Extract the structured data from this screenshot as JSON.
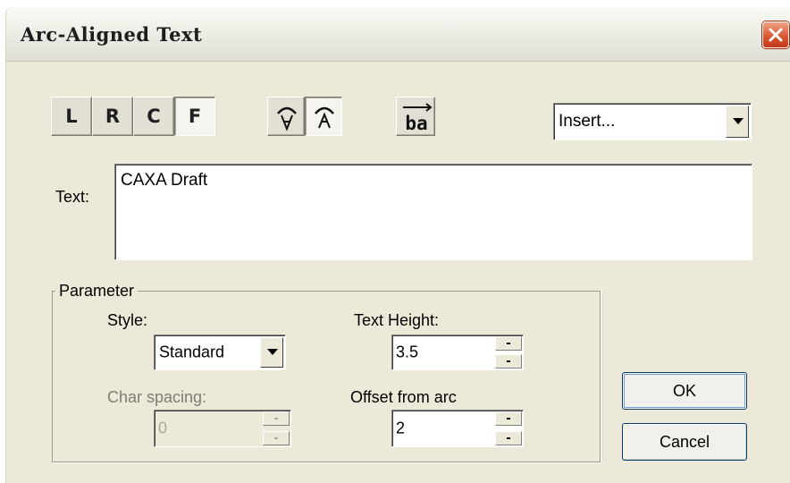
{
  "window": {
    "title": "Arc-Aligned Text"
  },
  "toolbar": {
    "align": [
      {
        "label": "L",
        "pressed": false
      },
      {
        "label": "R",
        "pressed": false
      },
      {
        "label": "C",
        "pressed": false
      },
      {
        "label": "F",
        "pressed": true
      }
    ],
    "arc_side_icons": [
      {
        "name": "text-below-arc-icon",
        "pressed": false
      },
      {
        "name": "text-above-arc-icon",
        "pressed": true
      }
    ],
    "reverse_text_icon": {
      "name": "reverse-text-direction-icon",
      "text": "ba"
    },
    "insert_dropdown": {
      "value": "Insert..."
    }
  },
  "text_field": {
    "label": "Text:",
    "value": "CAXA Draft"
  },
  "parameter": {
    "group_label": "Parameter",
    "style": {
      "label": "Style:",
      "value": "Standard"
    },
    "text_height": {
      "label": "Text Height:",
      "value": "3.5"
    },
    "char_spacing": {
      "label": "Char spacing:",
      "value": "0",
      "disabled": true
    },
    "offset_from_arc": {
      "label": "Offset from arc",
      "value": "2"
    }
  },
  "buttons": {
    "ok": "OK",
    "cancel": "Cancel"
  },
  "colors": {
    "dialog_bg": "#ece9d8",
    "close_button": "#d8532f",
    "default_button_ring": "#7a98d0"
  }
}
